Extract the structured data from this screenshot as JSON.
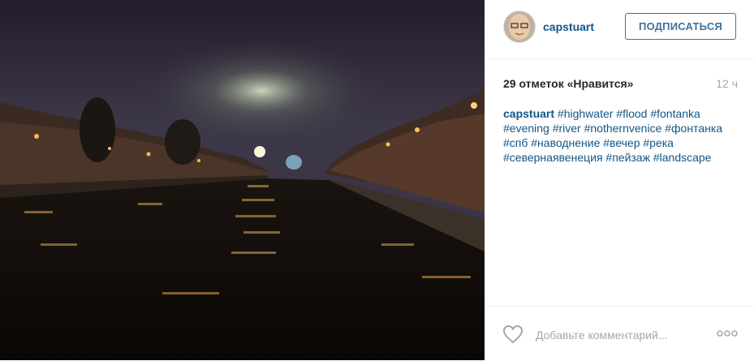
{
  "photo": {
    "alt": ""
  },
  "header": {
    "username": "capstuart",
    "follow_label": "ПОДПИСАТЬСЯ"
  },
  "post": {
    "likes": "29 отметок «Нравится»",
    "time": "12 ч",
    "caption_author": "capstuart",
    "caption_text": "#highwater #flood #fontanka #evening #river #nothernvenice #фонтанка #спб #наводнение #вечер #река #севернаявенеция #пейзаж #landscape"
  },
  "footer": {
    "comment_placeholder": "Добавьте комментарий..."
  },
  "colors": {
    "link": "#125688",
    "button": "#3f729b",
    "muted": "#a5a7aa"
  },
  "icons": [
    "heart-icon",
    "more-options-icon"
  ]
}
